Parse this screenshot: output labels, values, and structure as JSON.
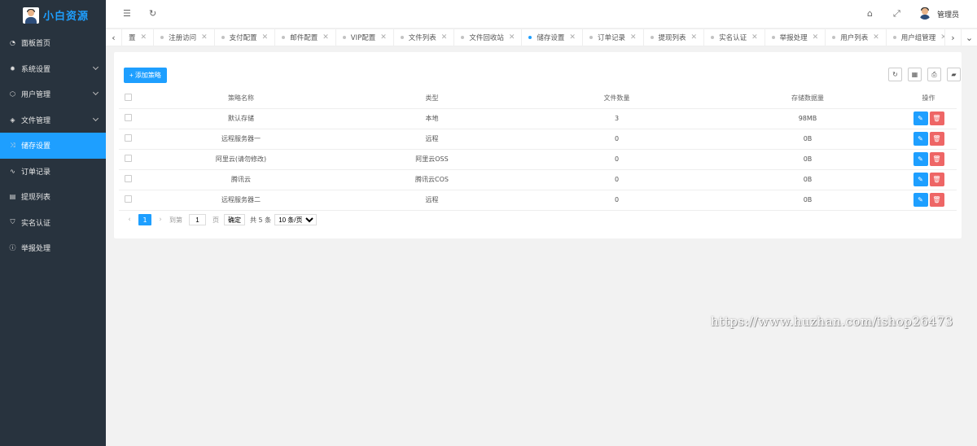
{
  "brand": {
    "name": "小白资源"
  },
  "sidebar": {
    "items": [
      {
        "label": "面板首页",
        "icon": "dashboard-icon",
        "chev": false,
        "active": false
      },
      {
        "label": "系统设置",
        "icon": "gear-icon",
        "chev": true,
        "active": false
      },
      {
        "label": "用户管理",
        "icon": "user-icon",
        "chev": true,
        "active": false
      },
      {
        "label": "文件管理",
        "icon": "layers-icon",
        "chev": true,
        "active": false
      },
      {
        "label": "储存设置",
        "icon": "shuffle-icon",
        "chev": false,
        "active": true
      },
      {
        "label": "订单记录",
        "icon": "pulse-icon",
        "chev": false,
        "active": false
      },
      {
        "label": "提现列表",
        "icon": "list-icon",
        "chev": false,
        "active": false
      },
      {
        "label": "实名认证",
        "icon": "shield-check-icon",
        "chev": false,
        "active": false
      },
      {
        "label": "举报处理",
        "icon": "alert-icon",
        "chev": false,
        "active": false
      }
    ]
  },
  "header": {
    "user_name": "管理员"
  },
  "tabs": [
    {
      "label": "置",
      "active": false,
      "dot": false
    },
    {
      "label": "注册访问",
      "active": false,
      "dot": true
    },
    {
      "label": "支付配置",
      "active": false,
      "dot": true
    },
    {
      "label": "邮件配置",
      "active": false,
      "dot": true
    },
    {
      "label": "VIP配置",
      "active": false,
      "dot": true
    },
    {
      "label": "文件列表",
      "active": false,
      "dot": true
    },
    {
      "label": "文件回收站",
      "active": false,
      "dot": true
    },
    {
      "label": "储存设置",
      "active": true,
      "dot": true
    },
    {
      "label": "订单记录",
      "active": false,
      "dot": true
    },
    {
      "label": "提现列表",
      "active": false,
      "dot": true
    },
    {
      "label": "实名认证",
      "active": false,
      "dot": true
    },
    {
      "label": "举报处理",
      "active": false,
      "dot": true
    },
    {
      "label": "用户列表",
      "active": false,
      "dot": true
    },
    {
      "label": "用户组管理",
      "active": false,
      "dot": true
    }
  ],
  "toolbar": {
    "add_label": "+ 添加策略"
  },
  "table": {
    "columns": [
      "策略名称",
      "类型",
      "文件数量",
      "存储数据量",
      "操作"
    ],
    "rows": [
      {
        "name": "默认存储",
        "type": "本地",
        "count": "3",
        "size": "98MB"
      },
      {
        "name": "远程服务器一",
        "type": "远程",
        "count": "0",
        "size": "0B"
      },
      {
        "name": "阿里云(请勿修改)",
        "type": "阿里云OSS",
        "count": "0",
        "size": "0B"
      },
      {
        "name": "腾讯云",
        "type": "腾讯云COS",
        "count": "0",
        "size": "0B"
      },
      {
        "name": "远程服务器二",
        "type": "远程",
        "count": "0",
        "size": "0B"
      }
    ]
  },
  "pager": {
    "current": "1",
    "goto_label": "到第",
    "goto_value": "1",
    "page_label": "页",
    "confirm_label": "确定",
    "total_label": "共 5 条",
    "page_size": "10 条/页"
  },
  "watermark": "https://www.huzhan.com/ishop26473",
  "colors": {
    "accent": "#1e9fff",
    "danger": "#ee6666",
    "sidebar_bg": "#28333e"
  }
}
